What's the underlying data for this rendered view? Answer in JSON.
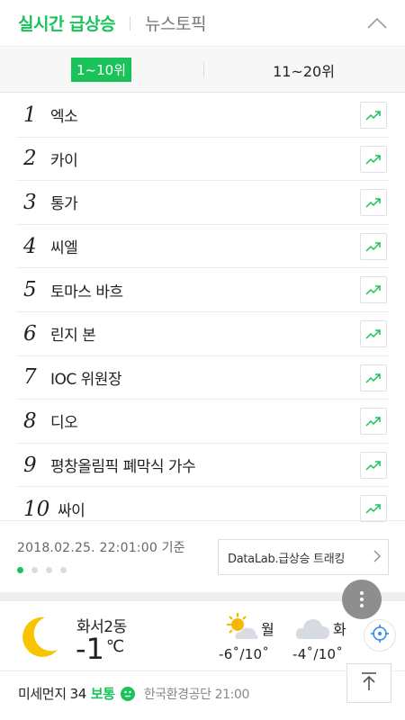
{
  "header": {
    "realtime_tab": "실시간 급상승",
    "news_tab": "뉴스토픽"
  },
  "range_tabs": [
    "1~10위",
    "11~20위"
  ],
  "ranking": [
    {
      "rank": "1",
      "keyword": "엑소"
    },
    {
      "rank": "2",
      "keyword": "카이"
    },
    {
      "rank": "3",
      "keyword": "통가"
    },
    {
      "rank": "4",
      "keyword": "씨엘"
    },
    {
      "rank": "5",
      "keyword": "토마스 바흐"
    },
    {
      "rank": "6",
      "keyword": "린지 본"
    },
    {
      "rank": "7",
      "keyword": "IOC 위원장"
    },
    {
      "rank": "8",
      "keyword": "디오"
    },
    {
      "rank": "9",
      "keyword": "평창올림픽 폐막식 가수"
    },
    {
      "rank": "10",
      "keyword": "싸이"
    }
  ],
  "footer": {
    "timestamp": "2018.02.25. 22:01:00 기준",
    "datalab_label": "DataLab.급상승 트래킹",
    "page_dots": 4,
    "active_dot": 0
  },
  "weather": {
    "location": "화서2동",
    "current_temp": "-1",
    "unit": "℃",
    "forecast": [
      {
        "day": "월",
        "temps": "-6˚/10˚",
        "icon": "sun-cloud-icon"
      },
      {
        "day": "화",
        "temps": "-4˚/10˚",
        "icon": "cloud-icon"
      }
    ]
  },
  "dust": {
    "label": "미세먼지",
    "value": "34",
    "status": "보통",
    "source": "한국환경공단 21:00"
  },
  "colors": {
    "accent": "#19c35a",
    "moon": "#f7c500",
    "fab": "#8e8e8e"
  }
}
